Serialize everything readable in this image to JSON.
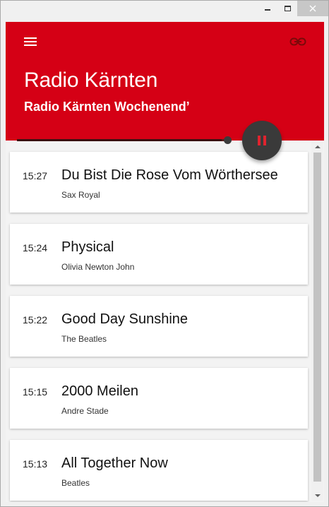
{
  "window": {
    "controls": [
      "minimize-icon",
      "maximize-icon",
      "close-icon"
    ]
  },
  "header": {
    "station": "Radio Kärnten",
    "program": "Radio Kärnten Wochenend’",
    "menu_icon": "hamburger-menu-icon",
    "link_icon": "link-icon",
    "accent_color": "#d50015"
  },
  "player": {
    "state_icon": "pause-icon",
    "progress": 0.98
  },
  "tracks": [
    {
      "time": "15:27",
      "title": "Du Bist Die Rose Vom Wörthersee",
      "artist": "Sax Royal"
    },
    {
      "time": "15:24",
      "title": "Physical",
      "artist": "Olivia Newton John"
    },
    {
      "time": "15:22",
      "title": "Good Day Sunshine",
      "artist": "The Beatles"
    },
    {
      "time": "15:15",
      "title": "2000 Meilen",
      "artist": "Andre Stade"
    },
    {
      "time": "15:13",
      "title": "All Together Now",
      "artist": "Beatles"
    }
  ]
}
